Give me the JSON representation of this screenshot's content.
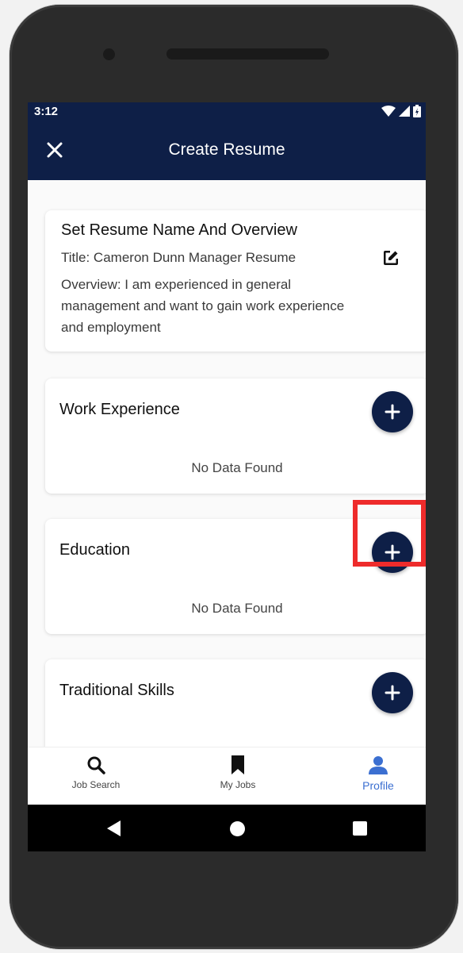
{
  "status_bar": {
    "time": "3:12"
  },
  "app_bar": {
    "title": "Create Resume",
    "close_icon": "close-icon"
  },
  "overview_card": {
    "title": "Set Resume Name And Overview",
    "subtitle": "Title: Cameron Dunn Manager Resume",
    "overview": "Overview: I am experienced in general management and want to gain work experience and employment",
    "edit_icon": "edit-icon"
  },
  "sections": [
    {
      "title": "Work Experience",
      "empty_text": "No Data Found"
    },
    {
      "title": "Education",
      "empty_text": "No Data Found"
    },
    {
      "title": "Traditional Skills"
    }
  ],
  "bottom_nav": {
    "items": [
      {
        "label": "Job Search",
        "icon": "search-icon"
      },
      {
        "label": "My Jobs",
        "icon": "bookmark-icon"
      },
      {
        "label": "Profile",
        "icon": "person-icon"
      }
    ],
    "active": "Profile"
  },
  "colors": {
    "app_bar": "#0e1f47",
    "fab": "#0e1f47",
    "active_nav": "#3b6fd1",
    "highlight": "#ee2b2b"
  }
}
